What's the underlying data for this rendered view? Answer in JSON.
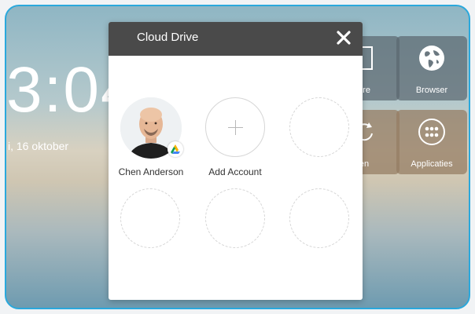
{
  "background": {
    "clock": "3:04",
    "date": "i, 16 oktober"
  },
  "tiles": [
    {
      "label": "are",
      "icon": "frame-icon"
    },
    {
      "label": "Browser",
      "icon": "globe-icon"
    },
    {
      "label": "en",
      "icon": "refresh-icon"
    },
    {
      "label": "Applicaties",
      "icon": "apps-grid-icon"
    }
  ],
  "dialog": {
    "title": "Cloud Drive",
    "close_icon": "close-icon",
    "accounts": [
      {
        "name": "Chen Anderson",
        "badge_icon": "google-drive-icon"
      }
    ],
    "add_account_label": "Add Account"
  },
  "colors": {
    "header": "#4a4a4a",
    "frame_border": "#2aa8dc"
  }
}
